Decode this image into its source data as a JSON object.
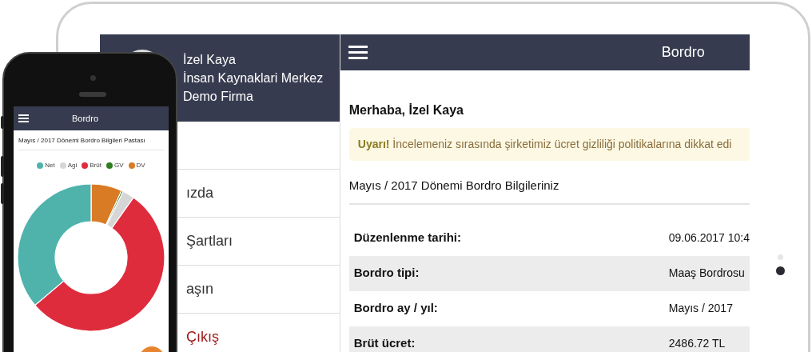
{
  "tablet": {
    "sidebar": {
      "user_lines": [
        "İzel Kaya",
        "İnsan Kaynaklari Merkez",
        "Demo Firma"
      ],
      "menu": [
        {
          "label": "ızda",
          "kind": "normal"
        },
        {
          "label": "Şartları",
          "kind": "normal"
        },
        {
          "label": "aşın",
          "kind": "normal"
        },
        {
          "label": "Çıkış",
          "kind": "logout"
        }
      ]
    },
    "header": {
      "title": "Bordro"
    },
    "greeting": "Merhaba, İzel Kaya",
    "alert": "**Uyarı!** İncelemeniz sırasında şirketimiz ücret gizliliği politikalarına dikkat edi",
    "section_title": "Mayıs / 2017 Dönemi Bordro Bilgileriniz",
    "details": [
      {
        "label": "Düzenlenme tarihi:",
        "value": "09.06.2017 10:4"
      },
      {
        "label": "Bordro tipi:",
        "value": "Maaş Bordrosu"
      },
      {
        "label": "Bordro ay / yıl:",
        "value": "Mayıs / 2017"
      },
      {
        "label": "Brüt ücret:",
        "value": "2486.72 TL"
      }
    ]
  },
  "phone": {
    "header": {
      "title": "Bordro"
    },
    "card_title": "Mayıs / 2017 Dönemi Bordro Bilgileri Pastası",
    "legend": [
      {
        "label": "Net",
        "color": "#4fb3ac"
      },
      {
        "label": "Agi",
        "color": "#d6d6d6"
      },
      {
        "label": "Brüt",
        "color": "#de2c3d"
      },
      {
        "label": "GV",
        "color": "#2e7d1e"
      },
      {
        "label": "DV",
        "color": "#d97b25"
      }
    ]
  }
}
